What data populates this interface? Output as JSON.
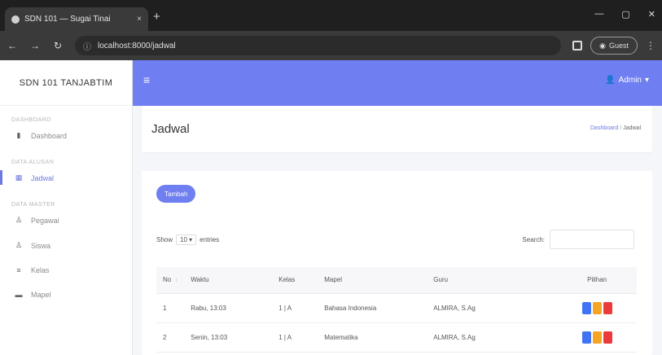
{
  "browser": {
    "tab_title": "SDN 101 — Sugai Tinai",
    "tab_close": "×",
    "newtab": "+",
    "url": "localhost:8000/jadwal",
    "guest": "Guest",
    "kebab": "⋮"
  },
  "sidebar": {
    "brand": "SDN 101 TANJABTIM",
    "sections": [
      {
        "title": "DASHBOARD"
      },
      {
        "title": "DATA ALUSAN"
      },
      {
        "title": "DATA MASTER"
      }
    ],
    "items": [
      {
        "label": "Dashboard",
        "icon": "dashboard-icon"
      },
      {
        "label": "Jadwal",
        "icon": "calendar-icon"
      },
      {
        "label": "Pegawai",
        "icon": "user-icon"
      },
      {
        "label": "Siswa",
        "icon": "users-icon"
      },
      {
        "label": "Kelas",
        "icon": "list-icon"
      },
      {
        "label": "Mapel",
        "icon": "book-icon"
      }
    ]
  },
  "topbar": {
    "user": "Admin"
  },
  "header": {
    "title": "Jadwal",
    "breadcrumb_home": "Dashboard",
    "breadcrumb_current": "Jadwal"
  },
  "content": {
    "add_button": "Tambah",
    "show_label": "Show",
    "show_value": "10",
    "entries_label": "entries",
    "search_label": "Search:",
    "columns": [
      "No",
      "Waktu",
      "Kelas",
      "Mapel",
      "Guru",
      "Pilihan"
    ],
    "rows": [
      {
        "no": "1",
        "waktu": "Rabu, 13:03",
        "kelas": "1 | A",
        "mapel": "Bahasa Indonesia",
        "guru": "ALMIRA, S.Ag"
      },
      {
        "no": "2",
        "waktu": "Senin, 13:03",
        "kelas": "1 | A",
        "mapel": "Matematika",
        "guru": "ALMIRA, S.Ag"
      }
    ]
  },
  "colors": {
    "primary": "#6f7ef0",
    "action_blue": "#3f74f4",
    "action_yellow": "#f5a524",
    "action_red": "#ec3b3b"
  }
}
